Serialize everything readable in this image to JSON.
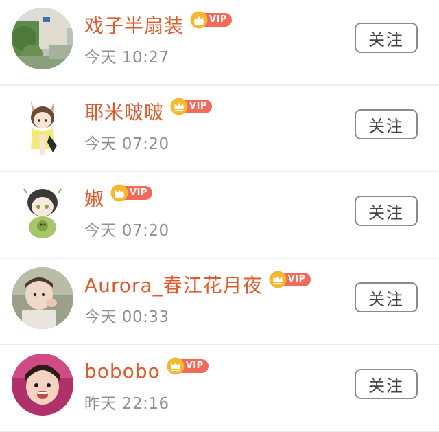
{
  "follow_list": {
    "items": [
      {
        "name": "戏子半扇装",
        "vip_label": "VIP",
        "time": "今天 10:27",
        "follow_label": "关注"
      },
      {
        "name": "耶米啵啵",
        "vip_label": "VIP",
        "time": "今天 07:20",
        "follow_label": "关注"
      },
      {
        "name": "婌",
        "vip_label": "VIP",
        "time": "今天 07:20",
        "follow_label": "关注"
      },
      {
        "name": "Aurora_春江花月夜",
        "vip_label": "VIP",
        "time": "今天 00:33",
        "follow_label": "关注"
      },
      {
        "name": "bobobo",
        "vip_label": "VIP",
        "time": "昨天 22:16",
        "follow_label": "关注"
      }
    ]
  },
  "colors": {
    "name": "#e05a2d",
    "vip_badge": "#f26a5a",
    "crown": "#f5b82e",
    "time": "#8f8f8f",
    "button_border": "#8a8a8a",
    "divider": "#eeeeee"
  },
  "icons": {
    "vip": "crown-icon"
  }
}
